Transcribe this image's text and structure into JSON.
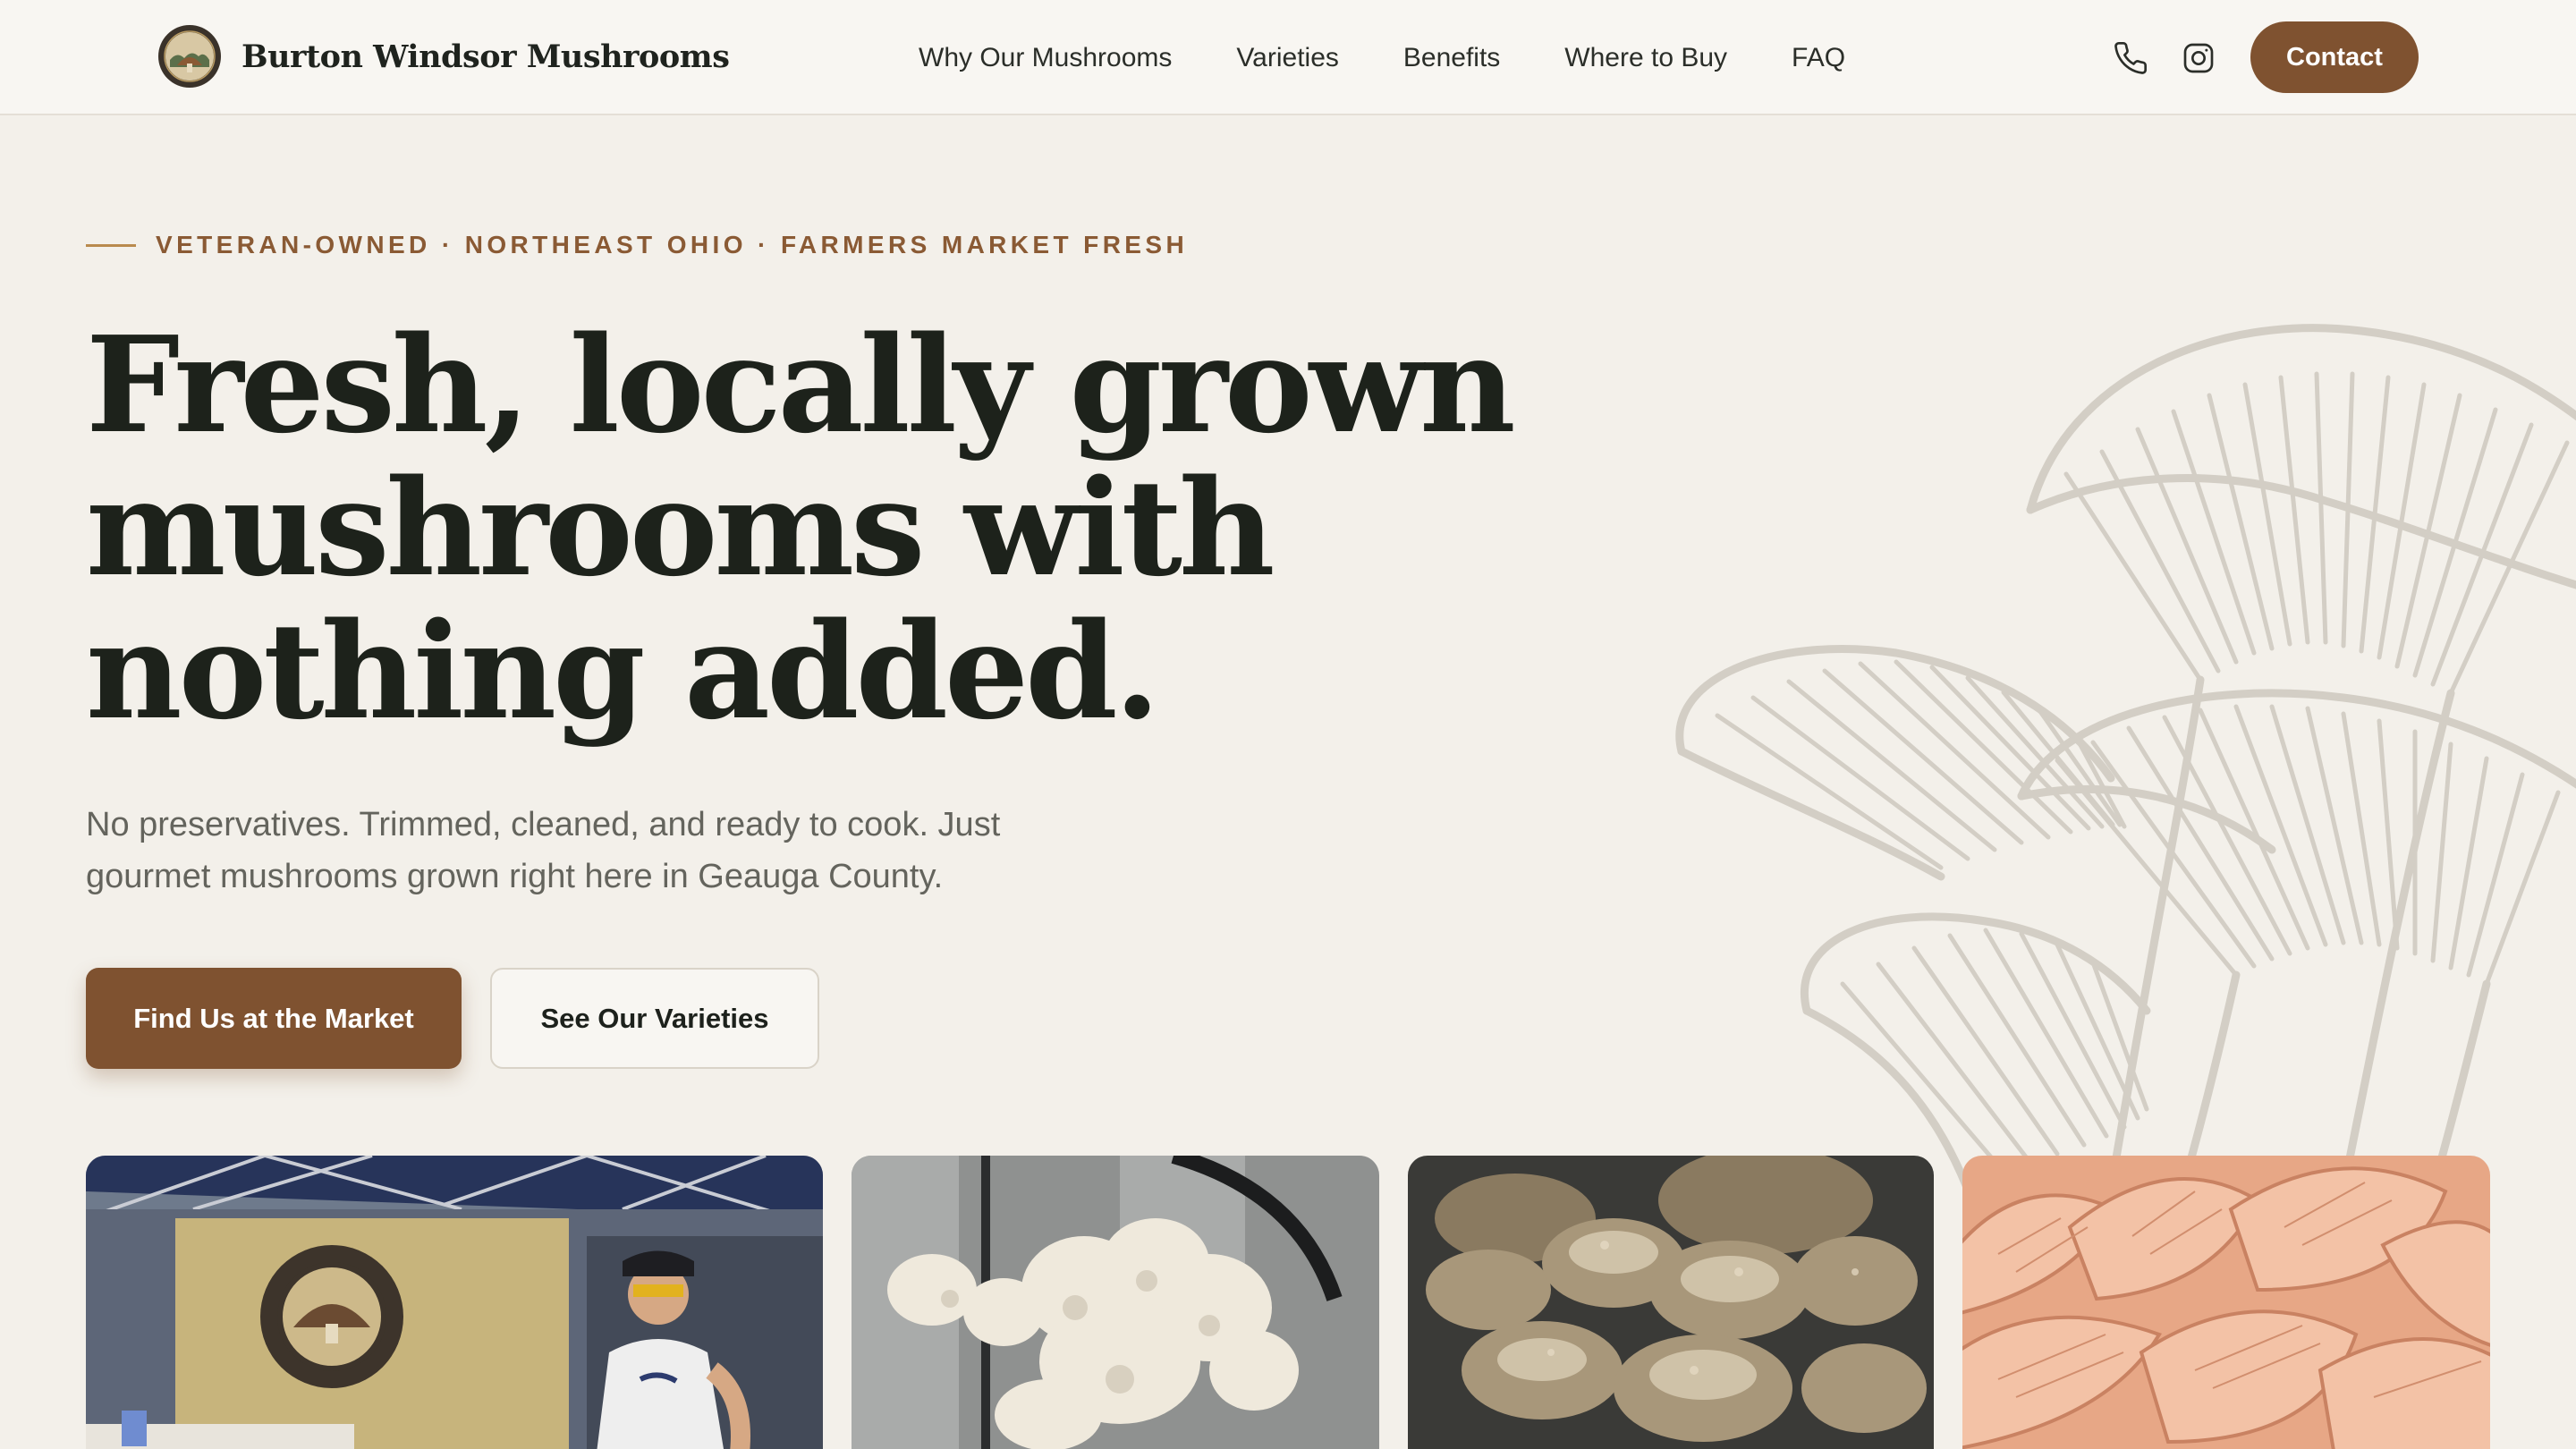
{
  "nav": {
    "brand": "Burton Windsor Mushrooms",
    "links": [
      "Why Our Mushrooms",
      "Varieties",
      "Benefits",
      "Where to Buy",
      "FAQ"
    ],
    "icons": [
      "phone-icon",
      "instagram-icon"
    ],
    "contact_label": "Contact"
  },
  "hero": {
    "eyebrow": "VETERAN-OWNED · NORTHEAST OHIO · FARMERS MARKET FRESH",
    "headline": "Fresh, locally grown mushrooms with nothing added.",
    "subcopy": "No preservatives. Trimmed, cleaned, and ready to cook. Just gourmet mushrooms grown right here in Geauga County.",
    "primary_cta": "Find Us at the Market",
    "secondary_cta": "See Our Varieties"
  },
  "gallery": [
    {
      "name": "market-booth-photo"
    },
    {
      "name": "lions-mane-photo"
    },
    {
      "name": "shiitake-photo"
    },
    {
      "name": "pink-oyster-photo"
    }
  ],
  "colors": {
    "accent": "#7f5230",
    "background": "#f3f0ea",
    "nav_background": "#f8f6f2",
    "eyebrow": "#8a5a34",
    "headline": "#1d221b"
  }
}
